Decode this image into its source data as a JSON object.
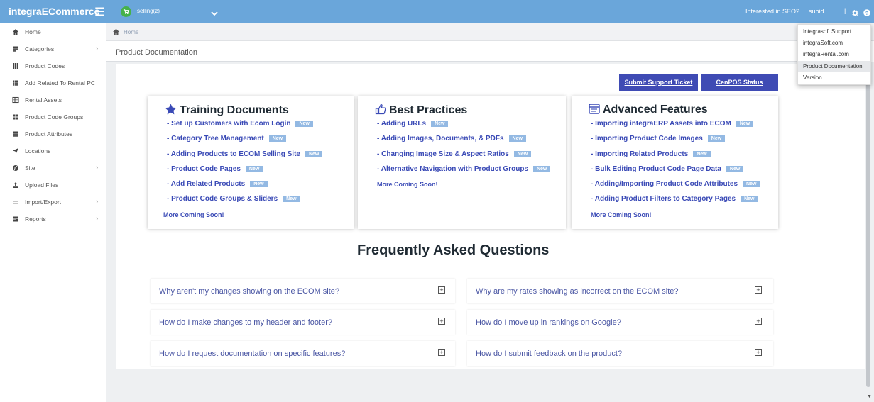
{
  "header": {
    "brand": "integraECommerce",
    "site_selector": "selling(z)",
    "seo_link": "Interested in SEO?",
    "user": "subid",
    "separator": "|"
  },
  "sidebar": {
    "items": [
      {
        "label": "Home",
        "icon": "home-icon",
        "has_submenu": false
      },
      {
        "label": "Categories",
        "icon": "categories-icon",
        "has_submenu": true
      },
      {
        "label": "Product Codes",
        "icon": "grid-icon",
        "has_submenu": false
      },
      {
        "label": "Add Related To Rental PC",
        "icon": "list-icon",
        "has_submenu": false
      },
      {
        "label": "Rental Assets",
        "icon": "table-icon",
        "has_submenu": false
      },
      {
        "label": "Product Code Groups",
        "icon": "groups-icon",
        "has_submenu": false
      },
      {
        "label": "Product Attributes",
        "icon": "list-icon",
        "has_submenu": false
      },
      {
        "label": "Locations",
        "icon": "location-arrow-icon",
        "has_submenu": false
      },
      {
        "label": "Site",
        "icon": "globe-icon",
        "has_submenu": true
      },
      {
        "label": "Upload Files",
        "icon": "upload-icon",
        "has_submenu": false
      },
      {
        "label": "Import/Export",
        "icon": "exchange-icon",
        "has_submenu": true
      },
      {
        "label": "Reports",
        "icon": "reports-icon",
        "has_submenu": true
      }
    ],
    "submenu_arrow": "›"
  },
  "breadcrumb": {
    "home": "Home"
  },
  "page": {
    "title": "Product Documentation"
  },
  "buttons": {
    "support_ticket": "Submit Support Ticket",
    "cenpos_status": "CenPOS Status"
  },
  "cards": [
    {
      "title": "Training Documents",
      "icon": "star-icon",
      "links": [
        {
          "text": "- Set up Customers with Ecom Login",
          "badge": "New"
        },
        {
          "text": "- Category Tree Management",
          "badge": "New"
        },
        {
          "text": "- Adding Products to ECOM Selling Site",
          "badge": "New"
        },
        {
          "text": "- Product Code Pages",
          "badge": "New"
        },
        {
          "text": "- Add Related Products",
          "badge": "New"
        },
        {
          "text": "- Product Code Groups & Sliders",
          "badge": "New"
        }
      ],
      "more": "More Coming Soon!"
    },
    {
      "title": "Best Practices",
      "icon": "thumbs-up-icon",
      "links": [
        {
          "text": "- Adding URLs",
          "badge": "New"
        },
        {
          "text": "- Adding Images, Documents, & PDFs",
          "badge": "New"
        },
        {
          "text": "- Changing Image Size & Aspect Ratios",
          "badge": "New"
        },
        {
          "text": "- Alternative Navigation with Product Groups",
          "badge": "New"
        }
      ],
      "more": "More Coming Soon!"
    },
    {
      "title": "Advanced Features",
      "icon": "window-icon",
      "links": [
        {
          "text": "- Importing integraERP Assets into ECOM",
          "badge": "New"
        },
        {
          "text": "- Importing Product Code Images",
          "badge": "New"
        },
        {
          "text": "- Importing Related Products",
          "badge": "New"
        },
        {
          "text": "- Bulk Editing Product Code Page Data",
          "badge": "New"
        },
        {
          "text": "- Adding/Importing Product Code Attributes",
          "badge": "New"
        },
        {
          "text": "- Adding Product Filters to Category Pages",
          "badge": "New"
        }
      ],
      "more": "More Coming Soon!"
    }
  ],
  "faq": {
    "title": "Frequently Asked Questions",
    "expand_symbol": "+",
    "questions": [
      "Why aren't my changes showing on the ECOM site?",
      "Why are my rates showing as incorrect on the ECOM site?",
      "How do I make changes to my header and footer?",
      "How do I move up in rankings on Google?",
      "How do I request documentation on specific features?",
      "How do I submit feedback on the product?"
    ]
  },
  "help_menu": {
    "items": [
      "Integrasoft Support",
      "integraSoft.com",
      "integraRental.com",
      "Product Documentation",
      "Version"
    ],
    "active_index": 3
  },
  "colors": {
    "topbar": "#6aa6da",
    "button": "#3f4bb4",
    "link": "#3a4ab6",
    "badge": "#93b9e3",
    "faq_text": "#4955a3",
    "cart_badge": "#46b14a"
  }
}
